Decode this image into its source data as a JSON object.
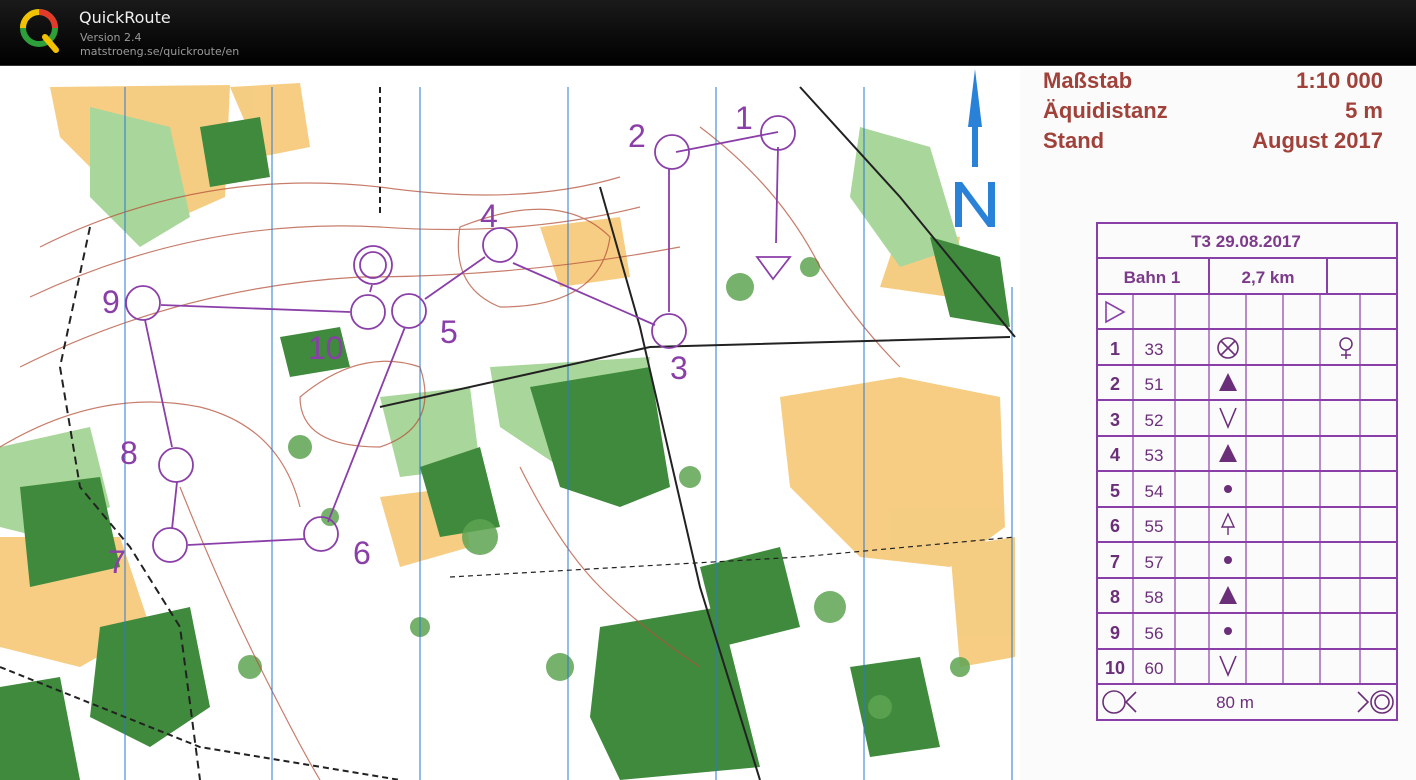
{
  "app": {
    "title": "QuickRoute",
    "version": "Version 2.4",
    "url": "matstroeng.se/quickroute/en",
    "logo_letter": "Q"
  },
  "legend": {
    "scale_label": "Maßstab",
    "scale_value": "1:10 000",
    "contour_label": "Äquidistanz",
    "contour_value": "5 m",
    "date_label": "Stand",
    "date_value": "August 2017"
  },
  "north_arrow": {
    "letter": "N",
    "color": "#2a82d8"
  },
  "course": {
    "color": "#8a3fa8",
    "control_labels": [
      "1",
      "2",
      "3",
      "4",
      "5",
      "6",
      "7",
      "8",
      "9",
      "10"
    ]
  },
  "control_card": {
    "title": "T3  29.08.2017",
    "course_name": "Bahn 1",
    "length": "2,7 km",
    "finish_distance": "80 m",
    "start_icon": "start-triangle-icon",
    "extra_symbol_row1": "water-point-icon",
    "rows": [
      {
        "num": "1",
        "code": "33",
        "symbol": "ruin-icon"
      },
      {
        "num": "2",
        "code": "51",
        "symbol": "boulder-icon"
      },
      {
        "num": "3",
        "code": "52",
        "symbol": "re-entrant-icon"
      },
      {
        "num": "4",
        "code": "53",
        "symbol": "boulder-icon"
      },
      {
        "num": "5",
        "code": "54",
        "symbol": "knoll-icon"
      },
      {
        "num": "6",
        "code": "55",
        "symbol": "distinctive-tree-icon"
      },
      {
        "num": "7",
        "code": "57",
        "symbol": "knoll-icon"
      },
      {
        "num": "8",
        "code": "58",
        "symbol": "boulder-icon"
      },
      {
        "num": "9",
        "code": "56",
        "symbol": "knoll-icon"
      },
      {
        "num": "10",
        "code": "60",
        "symbol": "re-entrant-icon"
      }
    ]
  },
  "colors": {
    "titlebar": "#000000",
    "legend_text": "#a0413a",
    "course": "#8a3fa8",
    "forest_dark": "#3f8a3c",
    "forest_light": "#9ed08e",
    "open_land": "#f7c66a",
    "contour": "#b5523a",
    "grid_line": "#2a78d0"
  }
}
